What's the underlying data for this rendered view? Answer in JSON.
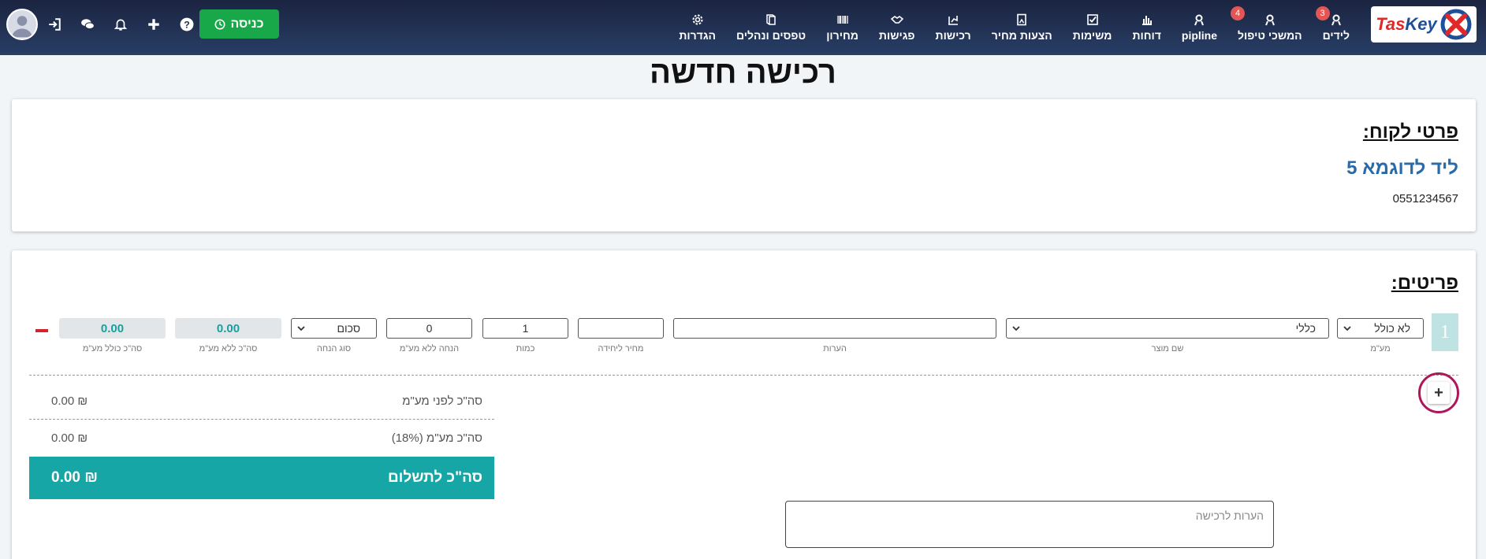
{
  "nav": {
    "items": [
      {
        "label": "לידים",
        "icon": "user-lead-icon",
        "badge": "3"
      },
      {
        "label": "המשכי טיפול",
        "icon": "user-followup-icon",
        "badge": "4"
      },
      {
        "label": "pipline",
        "icon": "pipeline-icon",
        "badge": ""
      },
      {
        "label": "דוחות",
        "icon": "bar-chart-icon",
        "badge": ""
      },
      {
        "label": "משימות",
        "icon": "check-square-icon",
        "badge": ""
      },
      {
        "label": "הצעות מחיר",
        "icon": "document-icon",
        "badge": ""
      },
      {
        "label": "רכישות",
        "icon": "purchase-chart-icon",
        "badge": ""
      },
      {
        "label": "פגישות",
        "icon": "handshake-icon",
        "badge": ""
      },
      {
        "label": "מחירון",
        "icon": "barcode-icon",
        "badge": ""
      },
      {
        "label": "טפסים ונהלים",
        "icon": "book-icon",
        "badge": ""
      },
      {
        "label": "הגדרות",
        "icon": "gear-icon",
        "badge": ""
      }
    ],
    "enter_label": "כניסה"
  },
  "page": {
    "title": "רכישה חדשה"
  },
  "customer": {
    "section_title": "פרטי לקוח:",
    "name": "ליד לדוגמא 5",
    "phone": "0551234567"
  },
  "items": {
    "section_title": "פריטים:",
    "row": {
      "number": "1",
      "vat_option": "לא כולל",
      "product": "כללי",
      "notes": "",
      "unit_price": "",
      "quantity": "1",
      "discount": "0",
      "discount_type": "סכום",
      "total_without_vat": "0.00",
      "total_with_vat": "0.00"
    },
    "labels": {
      "vat": "מע\"מ",
      "product": "שם מוצר",
      "notes": "הערות",
      "unit_price": "מחיר ליחידה",
      "quantity": "כמות",
      "discount": "הנחה ללא מע\"מ",
      "discount_type": "סוג הנחה",
      "total_without_vat": "סה\"כ ללא מע\"מ",
      "total_with_vat": "סה\"כ כולל מע\"מ"
    }
  },
  "summary": {
    "before_vat_label": "סה\"כ לפני מע\"מ",
    "before_vat_value": "0.00 ₪",
    "vat_label": "סה\"כ מע\"מ (18%)",
    "vat_value": "0.00 ₪",
    "total_label": "סה\"כ לתשלום",
    "total_value": "0.00 ₪"
  },
  "purchase_notes": {
    "placeholder": "הערות לרכישה"
  },
  "add_label": "+"
}
